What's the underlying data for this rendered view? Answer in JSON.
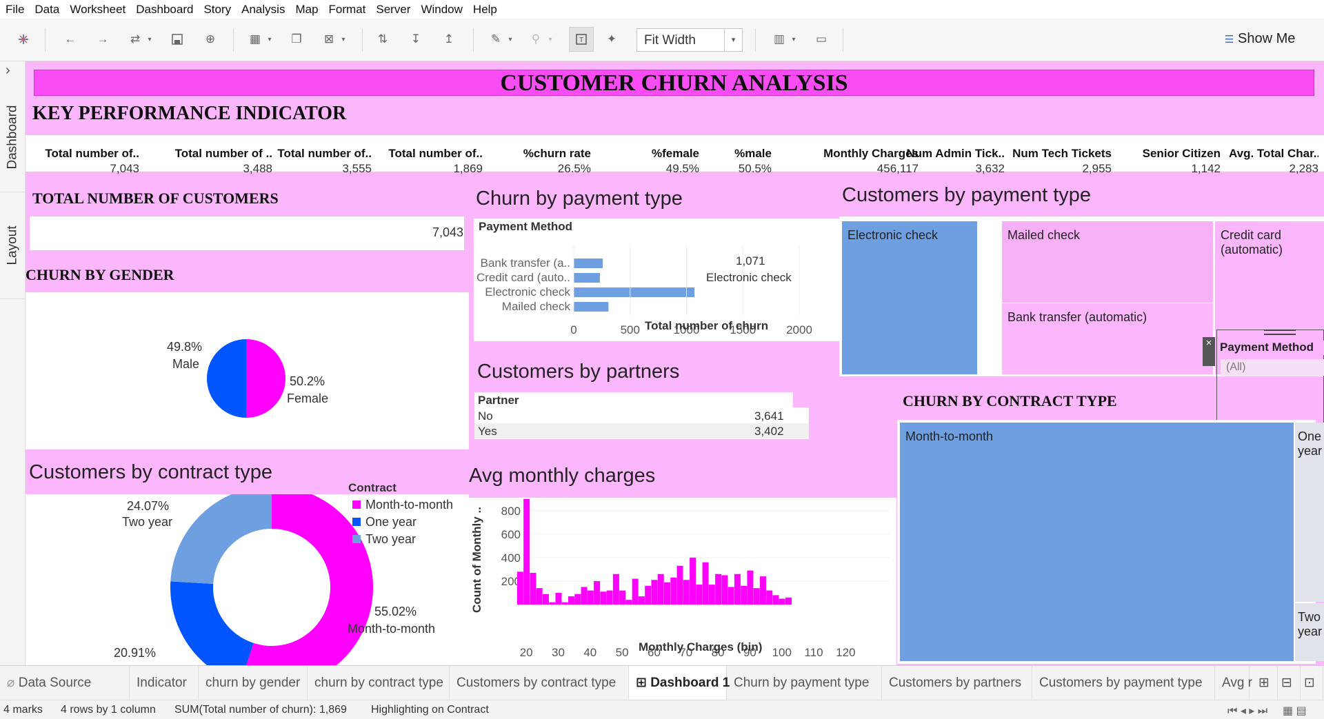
{
  "menu": [
    "File",
    "Data",
    "Worksheet",
    "Dashboard",
    "Story",
    "Analysis",
    "Map",
    "Format",
    "Server",
    "Window",
    "Help"
  ],
  "toolbar": {
    "fit_label": "Fit Width",
    "show_me": "Show Me",
    "dropdown_arrow": "▾"
  },
  "left_tabs": {
    "dashboard": "Dashboard",
    "layout": "Layout",
    "expand": "›"
  },
  "dashboard": {
    "title": "CUSTOMER CHURN ANALYSIS",
    "kpi_header": "KEY PERFORMANCE INDICATOR",
    "kpis": [
      {
        "label": "Total number of..",
        "value": "7,043"
      },
      {
        "label": "Total number of ..",
        "value": "3,488"
      },
      {
        "label": "Total number of..",
        "value": "3,555"
      },
      {
        "label": "Total number of..",
        "value": "1,869"
      },
      {
        "label": "%churn rate",
        "value": "26.5%"
      },
      {
        "label": "%female",
        "value": "49.5%"
      },
      {
        "label": "%male",
        "value": "50.5%"
      },
      {
        "label": "Monthly Charges",
        "value": "456,117"
      },
      {
        "label": "Num Admin Tick..",
        "value": "3,632"
      },
      {
        "label": "Num Tech Tickets",
        "value": "2,955"
      },
      {
        "label": "Senior Citizen",
        "value": "1,142"
      },
      {
        "label": "Avg. Total Char..",
        "value": "2,283"
      }
    ],
    "total_customers": {
      "title": "TOTAL NUMBER OF CUSTOMERS",
      "value": "7,043"
    },
    "gender": {
      "title": "CHURN BY GENDER",
      "male_pct": "49.8%",
      "male_label": "Male",
      "female_pct": "50.2%",
      "female_label": "Female"
    },
    "contract_donut": {
      "title": "Customers by contract type",
      "legend_title": "Contract",
      "legend": [
        "Month-to-month",
        "One year",
        "Two year"
      ],
      "two_year_pct": "24.07%",
      "two_year_label": "Two year",
      "one_year_pct": "20.91%",
      "mtm_pct": "55.02%",
      "mtm_label": "Month-to-month"
    },
    "payment_churn": {
      "title": "Churn by payment type",
      "header": "Payment Method",
      "xlabel": "Total number of churn",
      "annotation_value": "1,071",
      "annotation_label": "Electronic check"
    },
    "partners": {
      "title": "Customers by partners",
      "header": "Partner",
      "rows": [
        {
          "label": "No",
          "value": "3,641"
        },
        {
          "label": "Yes",
          "value": "3,402"
        }
      ]
    },
    "avg_charges": {
      "title": "Avg monthly charges",
      "ylabel": "Count of Monthly ..",
      "xlabel": "Monthly Charges (bin)"
    },
    "payment_tree": {
      "title": "Customers by payment type",
      "cells": [
        "Electronic check",
        "Mailed check",
        "Credit card (automatic)",
        "Bank transfer (automatic)"
      ]
    },
    "filter": {
      "title": "Payment Method",
      "value": "(All)",
      "close": "×"
    },
    "contract_tree": {
      "title": "CHURN BY CONTRACT TYPE",
      "cells": [
        "Month-to-month",
        "One year",
        "Two year"
      ]
    }
  },
  "colors": {
    "pink": "#ff00ff",
    "blue": "#0055ff",
    "light_blue": "#6e9fe0",
    "bg_pink": "#fcb6fc",
    "banner": "#f94cf4",
    "tree_pink": "#f7b0f5"
  },
  "chart_data": [
    {
      "type": "bar",
      "title": "Churn by payment type",
      "categories": [
        "Bank transfer (a..",
        "Credit card (auto..",
        "Electronic check",
        "Mailed check"
      ],
      "values": [
        258,
        232,
        1071,
        308
      ],
      "xlabel": "Total number of churn",
      "ylabel": "Payment Method",
      "xlim": [
        0,
        2000
      ],
      "ticks": [
        0,
        500,
        1000,
        1500,
        2000
      ]
    },
    {
      "type": "pie",
      "title": "CHURN BY GENDER",
      "categories": [
        "Male",
        "Female"
      ],
      "values": [
        49.8,
        50.2
      ]
    },
    {
      "type": "pie",
      "title": "Customers by contract type",
      "categories": [
        "Month-to-month",
        "One year",
        "Two year"
      ],
      "values": [
        55.02,
        20.91,
        24.07
      ],
      "donut": true
    },
    {
      "type": "bar",
      "title": "Avg monthly charges",
      "xlabel": "Monthly Charges (bin)",
      "ylabel": "Count of Monthly ..",
      "x": [
        18,
        20,
        22,
        24,
        26,
        28,
        30,
        32,
        34,
        36,
        38,
        40,
        42,
        44,
        46,
        48,
        50,
        52,
        54,
        56,
        58,
        60,
        62,
        64,
        66,
        68,
        70,
        72,
        74,
        76,
        78,
        80,
        82,
        84,
        86,
        88,
        90,
        92,
        94,
        96,
        98,
        100,
        102,
        104,
        106,
        108,
        110,
        112,
        114,
        116,
        118
      ],
      "values": [
        280,
        900,
        270,
        140,
        90,
        20,
        100,
        20,
        70,
        90,
        150,
        120,
        200,
        110,
        120,
        260,
        120,
        40,
        220,
        70,
        160,
        210,
        260,
        190,
        230,
        330,
        210,
        400,
        170,
        360,
        170,
        260,
        250,
        150,
        260,
        160,
        290,
        140,
        240,
        120,
        80,
        50,
        60,
        0,
        0,
        0,
        0,
        0,
        0,
        0,
        0
      ],
      "xticks": [
        20,
        30,
        40,
        50,
        60,
        70,
        80,
        90,
        100,
        110,
        120
      ],
      "yticks": [
        200,
        400,
        600,
        800
      ],
      "ylim": [
        0,
        950
      ]
    }
  ],
  "tabs": [
    "Data Source",
    "Indicator",
    "churn by gender",
    "churn by contract type",
    "Customers by contract type",
    "Dashboard 1",
    "Churn by payment type",
    "Customers by partners",
    "Customers by payment type",
    "Avg r"
  ],
  "status": {
    "marks": "4 marks",
    "rows": "4 rows by 1 column",
    "sum": "SUM(Total number of churn): 1,869",
    "highlight": "Highlighting on Contract"
  }
}
